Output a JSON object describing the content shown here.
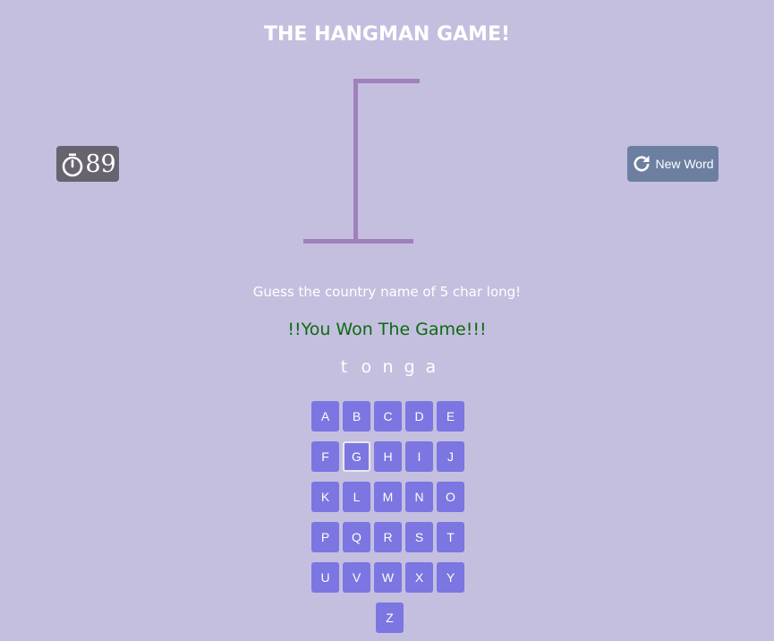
{
  "header": {
    "title": "THE HANGMAN GAME!"
  },
  "timer": {
    "icon": "stopwatch-icon",
    "value": "89"
  },
  "new_word_button": {
    "icon": "refresh-icon",
    "label": "New Word"
  },
  "game": {
    "hint": "Guess the country name of 5 char long!",
    "result": "!!You Won The Game!!!",
    "word_letters": [
      "t",
      "o",
      "n",
      "g",
      "a"
    ]
  },
  "keyboard": {
    "rows": [
      [
        "A",
        "B",
        "C",
        "D",
        "E"
      ],
      [
        "F",
        "G",
        "H",
        "I",
        "J"
      ],
      [
        "K",
        "L",
        "M",
        "N",
        "O"
      ],
      [
        "P",
        "Q",
        "R",
        "S",
        "T"
      ],
      [
        "U",
        "V",
        "W",
        "X",
        "Y"
      ],
      [
        "Z"
      ]
    ],
    "focused_key": "G"
  },
  "colors": {
    "background": "#c4bfdf",
    "gallows": "#a080bd",
    "timer_bg": "#67636f",
    "new_word_bg": "#6c7fa0",
    "key_bg": "#7b76e1",
    "win_text": "#0b6a10"
  }
}
